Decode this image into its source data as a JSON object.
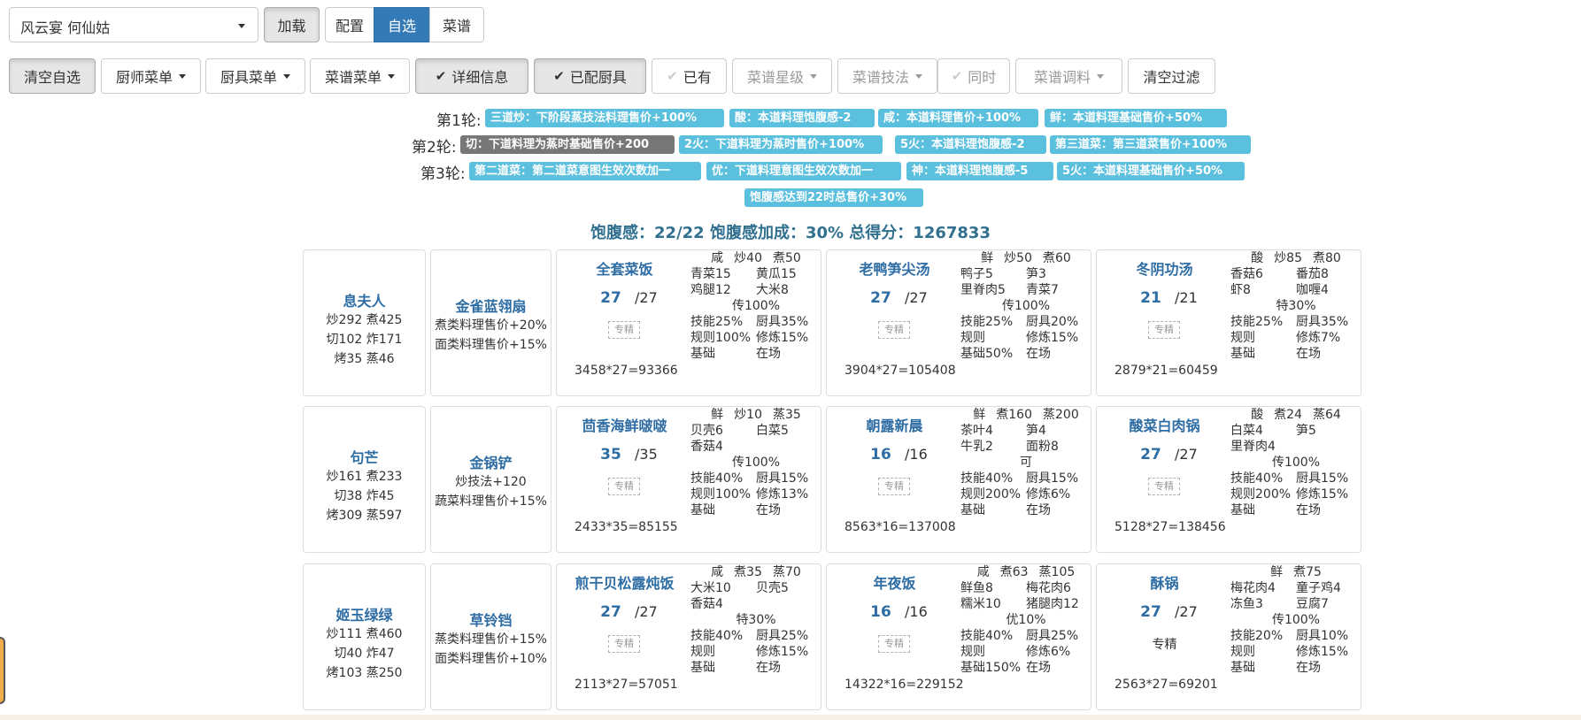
{
  "top": {
    "select_value": "风云宴 何仙姑",
    "load_label": "加载",
    "tabs": [
      {
        "label": "配置",
        "active": false
      },
      {
        "label": "自选",
        "active": true
      },
      {
        "label": "菜谱",
        "active": false
      }
    ]
  },
  "toolbar": {
    "clear_selection": "清空自选",
    "chef_menu": "厨师菜单",
    "equip_menu": "厨具菜单",
    "recipe_menu": "菜谱菜单",
    "details": "详细信息",
    "equipped": "已配厨具",
    "owned": "已有",
    "rarity": "菜谱星级",
    "skill": "菜谱技法",
    "simultaneous": "同时",
    "condiment": "菜谱调料",
    "clear_filter": "清空过滤"
  },
  "rounds": [
    {
      "label": "第1轮:",
      "tags": [
        {
          "text": "三道炒：下阶段蒸技法料理售价+100%",
          "gray": false
        },
        {
          "text": "酸：本道料理饱腹感-2",
          "gray": false
        },
        {
          "text": "咸：本道料理售价+100%",
          "gray": false
        },
        {
          "text": "鲜：本道料理基础售价+50%",
          "gray": false
        }
      ]
    },
    {
      "label": "第2轮:",
      "tags": [
        {
          "text": "切：下道料理为蒸时基础售价+200",
          "gray": true
        },
        {
          "text": "2火：下道料理为蒸时售价+100%",
          "gray": false
        },
        {
          "text": "5火：本道料理饱腹感-2",
          "gray": false
        },
        {
          "text": "第三道菜：第三道菜售价+100%",
          "gray": false
        }
      ]
    },
    {
      "label": "第3轮:",
      "tags": [
        {
          "text": "第二道菜：第二道菜意图生效次数加一",
          "gray": false
        },
        {
          "text": "优：下道料理意图生效次数加一",
          "gray": false
        },
        {
          "text": "神：本道料理饱腹感-5",
          "gray": false
        },
        {
          "text": "5火：本道料理基础售价+50%",
          "gray": false
        }
      ]
    },
    {
      "label": "",
      "tags": [
        {
          "text": "饱腹感达到22时总售价+30%",
          "gray": false
        }
      ]
    }
  ],
  "summary": "饱腹感：22/22 饱腹感加成：30% 总得分：1267833",
  "rows": [
    {
      "chef": {
        "name": "息夫人",
        "stats": [
          "炒292 煮425",
          "切102 炸171",
          "烤35 蒸46"
        ]
      },
      "equip": {
        "name": "金雀蓝翎扇",
        "effects": [
          "煮类料理售价+20%",
          "面类料理售价+15%"
        ]
      },
      "recipes": [
        {
          "name": "全套菜饭",
          "qty": "27",
          "total": "/27",
          "equip": "专精",
          "calc": "3458*27=93366",
          "header": [
            "咸",
            "炒40",
            "煮50"
          ],
          "ingredients": [
            [
              "青菜15",
              "黄瓜15"
            ],
            [
              "鸡腿12",
              "大米8"
            ]
          ],
          "grade": "传100%",
          "skill": [
            "技能25%",
            "厨具35%"
          ],
          "rule": [
            "规则100%",
            "修炼15%"
          ],
          "base": [
            "基础",
            "在场"
          ]
        },
        {
          "name": "老鸭笋尖汤",
          "qty": "27",
          "total": "/27",
          "equip": "专精",
          "calc": "3904*27=105408",
          "header": [
            "鲜",
            "炒50",
            "煮60"
          ],
          "ingredients": [
            [
              "鸭子5",
              "笋3"
            ],
            [
              "里脊肉5",
              "青菜7"
            ]
          ],
          "grade": "传100%",
          "skill": [
            "技能25%",
            "厨具20%"
          ],
          "rule": [
            "规则",
            "修炼15%"
          ],
          "base": [
            "基础50%",
            "在场"
          ]
        },
        {
          "name": "冬阴功汤",
          "qty": "21",
          "total": "/21",
          "equip": "专精",
          "calc": "2879*21=60459",
          "header": [
            "酸",
            "炒85",
            "煮80"
          ],
          "ingredients": [
            [
              "香菇6",
              "番茄8"
            ],
            [
              "虾8",
              "咖喱4"
            ]
          ],
          "grade": "特30%",
          "skill": [
            "技能25%",
            "厨具35%"
          ],
          "rule": [
            "规则",
            "修炼7%"
          ],
          "base": [
            "基础",
            "在场"
          ]
        }
      ]
    },
    {
      "chef": {
        "name": "句芒",
        "stats": [
          "炒161 煮233",
          "切38 炸45",
          "烤309 蒸597"
        ]
      },
      "equip": {
        "name": "金锅铲",
        "effects": [
          "炒技法+120",
          "蔬菜料理售价+15%"
        ]
      },
      "recipes": [
        {
          "name": "茴香海鲜啵啵",
          "qty": "35",
          "total": "/35",
          "equip": "专精",
          "calc": "2433*35=85155",
          "header": [
            "鲜",
            "炒10",
            "蒸35"
          ],
          "ingredients": [
            [
              "贝壳6",
              "白菜5"
            ],
            [
              "香菇4",
              ""
            ]
          ],
          "grade": "传100%",
          "skill": [
            "技能40%",
            "厨具15%"
          ],
          "rule": [
            "规则100%",
            "修炼13%"
          ],
          "base": [
            "基础",
            "在场"
          ]
        },
        {
          "name": "朝露新晨",
          "qty": "16",
          "total": "/16",
          "equip": "专精",
          "calc": "8563*16=137008",
          "header": [
            "鲜",
            "煮160",
            "蒸200"
          ],
          "ingredients": [
            [
              "茶叶4",
              "笋4"
            ],
            [
              "牛乳2",
              "面粉8"
            ]
          ],
          "grade": "可",
          "skill": [
            "技能40%",
            "厨具15%"
          ],
          "rule": [
            "规则200%",
            "修炼6%"
          ],
          "base": [
            "基础",
            "在场"
          ]
        },
        {
          "name": "酸菜白肉锅",
          "qty": "27",
          "total": "/27",
          "equip": "专精",
          "calc": "5128*27=138456",
          "header": [
            "酸",
            "煮24",
            "蒸64"
          ],
          "ingredients": [
            [
              "白菜4",
              "笋5"
            ],
            [
              "里脊肉4",
              ""
            ]
          ],
          "grade": "传100%",
          "skill": [
            "技能40%",
            "厨具15%"
          ],
          "rule": [
            "规则200%",
            "修炼15%"
          ],
          "base": [
            "基础",
            "在场"
          ]
        }
      ]
    },
    {
      "chef": {
        "name": "姬玉绿绿",
        "stats": [
          "炒111 煮460",
          "切40 炸47",
          "烤103 蒸250"
        ]
      },
      "equip": {
        "name": "草铃铛",
        "effects": [
          "蒸类料理售价+15%",
          "面类料理售价+10%"
        ]
      },
      "recipes": [
        {
          "name": "煎干贝松露炖饭",
          "qty": "27",
          "total": "/27",
          "equip": "专精",
          "calc": "2113*27=57051",
          "header": [
            "咸",
            "煮35",
            "蒸70"
          ],
          "ingredients": [
            [
              "大米10",
              "贝壳5"
            ],
            [
              "香菇4",
              ""
            ]
          ],
          "grade": "特30%",
          "skill": [
            "技能40%",
            "厨具25%"
          ],
          "rule": [
            "规则",
            "修炼15%"
          ],
          "base": [
            "基础",
            "在场"
          ]
        },
        {
          "name": "年夜饭",
          "qty": "16",
          "total": "/16",
          "equip": "专精",
          "calc": "14322*16=229152",
          "header": [
            "咸",
            "煮63",
            "蒸105"
          ],
          "ingredients": [
            [
              "鲜鱼8",
              "梅花肉6"
            ],
            [
              "糯米10",
              "猪腿肉12"
            ]
          ],
          "grade": "优10%",
          "skill": [
            "技能40%",
            "厨具25%"
          ],
          "rule": [
            "规则",
            "修炼6%"
          ],
          "base": [
            "基础150%",
            "在场"
          ]
        },
        {
          "name": "酥锅",
          "qty": "27",
          "total": "/27",
          "equip": "专精",
          "equip_text": true,
          "calc": "2563*27=69201",
          "header": [
            "鲜",
            "煮75"
          ],
          "ingredients": [
            [
              "梅花肉4",
              "童子鸡4"
            ],
            [
              "冻鱼3",
              "豆腐7"
            ]
          ],
          "grade": "传100%",
          "skill": [
            "技能20%",
            "厨具10%"
          ],
          "rule": [
            "规则",
            "修炼15%"
          ],
          "base": [
            "基础",
            "在场"
          ]
        }
      ]
    }
  ],
  "colors": {
    "primary": "#337ab7",
    "info": "#5bc0de",
    "title": "#31708f",
    "gray": "#777777"
  }
}
